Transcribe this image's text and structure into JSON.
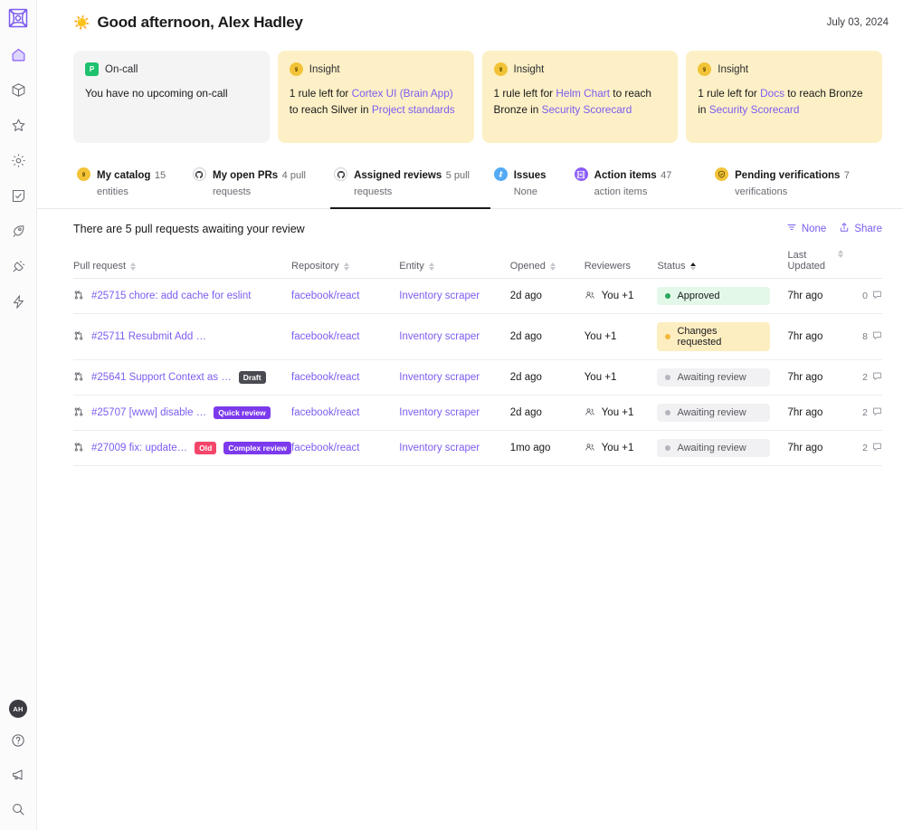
{
  "sidebar": {
    "logo_name": "cortex-logo",
    "items": [
      {
        "name": "home",
        "icon": "home-icon",
        "active": true
      },
      {
        "name": "catalog",
        "icon": "cube-icon",
        "active": false
      },
      {
        "name": "favorites",
        "icon": "star-icon",
        "active": false
      },
      {
        "name": "settings",
        "icon": "gear-icon",
        "active": false
      },
      {
        "name": "scorecards",
        "icon": "checklist-icon",
        "active": false
      },
      {
        "name": "initiatives",
        "icon": "rocket-icon",
        "active": false
      },
      {
        "name": "integrations",
        "icon": "plug-icon",
        "active": false
      },
      {
        "name": "workflows",
        "icon": "lightning-icon",
        "active": false
      }
    ],
    "bottom": [
      {
        "name": "user-avatar",
        "label": "AH"
      },
      {
        "name": "help",
        "icon": "question-icon"
      },
      {
        "name": "announcements",
        "icon": "megaphone-icon"
      },
      {
        "name": "search",
        "icon": "search-icon"
      }
    ]
  },
  "header": {
    "emoji": "☀️",
    "greeting": "Good afternoon, Alex Hadley",
    "date": "July 03, 2024"
  },
  "cards": [
    {
      "type": "oncall",
      "icon": "pagerduty-icon",
      "icon_glyph": "P",
      "label": "On-call",
      "body_prefix": "You have no upcoming on-call",
      "body_parts": []
    },
    {
      "type": "insight",
      "icon": "lightbulb-icon",
      "icon_glyph": "●",
      "label": "Insight",
      "body_prefix": "1 rule left for ",
      "link1": "Cortex UI (Brain App)",
      "mid": " to reach Silver in ",
      "link2": "Project standards",
      "suffix": ""
    },
    {
      "type": "insight",
      "icon": "lightbulb-icon",
      "icon_glyph": "●",
      "label": "Insight",
      "body_prefix": "1 rule left for ",
      "link1": "Helm Chart",
      "mid": " to reach Bronze in ",
      "link2": "Security Scorecard",
      "suffix": ""
    },
    {
      "type": "insight",
      "icon": "lightbulb-icon",
      "icon_glyph": "●",
      "label": "Insight",
      "body_prefix": "1 rule left for ",
      "link1": "Docs",
      "mid": " to reach Bronze in ",
      "link2": "Security Scorecard",
      "suffix": ""
    }
  ],
  "tabs": [
    {
      "icon": "lightbulb-icon",
      "icon_kind": "yellow",
      "label": "My catalog",
      "sub": "15 entities",
      "active": false
    },
    {
      "icon": "github-icon",
      "icon_kind": "gh",
      "label": "My open PRs",
      "sub": "4 pull requests",
      "active": false
    },
    {
      "icon": "github-icon",
      "icon_kind": "gh",
      "label": "Assigned reviews",
      "sub": "5 pull requests",
      "active": true
    },
    {
      "icon": "jira-icon",
      "icon_kind": "blue",
      "label": "Issues",
      "sub": "None",
      "active": false
    },
    {
      "icon": "cortex-icon",
      "icon_kind": "purple",
      "label": "Action items",
      "sub": "47 action items",
      "active": false
    },
    {
      "icon": "shield-check-icon",
      "icon_kind": "yellow",
      "label": "Pending verifications",
      "sub": "7 verifications",
      "active": false
    }
  ],
  "list": {
    "title": "There are 5 pull requests awaiting your review",
    "group_by_label": "None",
    "group_by_icon": "filter-icon",
    "share_label": "Share",
    "share_icon": "share-icon"
  },
  "table": {
    "columns": [
      {
        "key": "pull_request",
        "label": "Pull request",
        "sortable": true,
        "sorted": "none"
      },
      {
        "key": "repository",
        "label": "Repository",
        "sortable": true,
        "sorted": "none"
      },
      {
        "key": "entity",
        "label": "Entity",
        "sortable": true,
        "sorted": "none"
      },
      {
        "key": "opened",
        "label": "Opened",
        "sortable": true,
        "sorted": "none"
      },
      {
        "key": "reviewers",
        "label": "Reviewers",
        "sortable": false,
        "sorted": "none"
      },
      {
        "key": "status",
        "label": "Status",
        "sortable": true,
        "sorted": "asc"
      },
      {
        "key": "last_updated",
        "label": "Last Updated",
        "sortable": true,
        "sorted": "none"
      }
    ],
    "rows": [
      {
        "icon": "pull-request-icon",
        "pull_request": "#25715 chore: add cache for eslint",
        "tags": [],
        "repository": "facebook/react",
        "entity": "Inventory scraper",
        "opened": "2d ago",
        "reviewers": "You +1",
        "reviewers_icon": true,
        "status": "Approved",
        "status_kind": "approved",
        "last_updated": "7hr ago",
        "comments": "0"
      },
      {
        "icon": "pull-request-icon",
        "pull_request": "#25711 Resubmit Add …",
        "tags": [],
        "repository": "facebook/react",
        "entity": "Inventory scraper",
        "opened": "2d ago",
        "reviewers": "You +1",
        "reviewers_icon": false,
        "status": "Changes requested",
        "status_kind": "changes",
        "last_updated": "7hr ago",
        "comments": "8"
      },
      {
        "icon": "pull-request-icon",
        "pull_request": "#25641 Support Context as …",
        "tags": [
          {
            "label": "Draft",
            "kind": "draft"
          }
        ],
        "repository": "facebook/react",
        "entity": "Inventory scraper",
        "opened": "2d ago",
        "reviewers": "You +1",
        "reviewers_icon": false,
        "status": "Awaiting review",
        "status_kind": "awaiting",
        "last_updated": "7hr ago",
        "comments": "2"
      },
      {
        "icon": "pull-request-icon",
        "pull_request": "#25707 [www] disable …",
        "tags": [
          {
            "label": "Quick review",
            "kind": "quick"
          }
        ],
        "repository": "facebook/react",
        "entity": "Inventory scraper",
        "opened": "2d ago",
        "reviewers": "You +1",
        "reviewers_icon": true,
        "status": "Awaiting review",
        "status_kind": "awaiting",
        "last_updated": "7hr ago",
        "comments": "2"
      },
      {
        "icon": "pull-request-icon",
        "pull_request": "#27009 fix: update…",
        "tags": [
          {
            "label": "Old",
            "kind": "old"
          },
          {
            "label": "Complex review",
            "kind": "complex"
          }
        ],
        "repository": "facebook/react",
        "entity": "Inventory scraper",
        "opened": "1mo ago",
        "reviewers": "You +1",
        "reviewers_icon": true,
        "status": "Awaiting review",
        "status_kind": "awaiting",
        "last_updated": "7hr ago",
        "comments": "2"
      }
    ]
  },
  "colors": {
    "accent": "#7c5cf0",
    "insight_bg": "#fdf0c6",
    "oncall_bg": "#f4f4f5",
    "approved_bg": "#e3f8e9",
    "approved_dot": "#2aa85c",
    "changes_bg": "#fdeec2",
    "changes_dot": "#f2b93b",
    "awaiting_bg": "#f1f1f3",
    "awaiting_dot": "#b4b4bc",
    "tag_purple": "#7c3aed",
    "tag_red": "#f4456b",
    "tag_dark": "#4a4a52"
  }
}
